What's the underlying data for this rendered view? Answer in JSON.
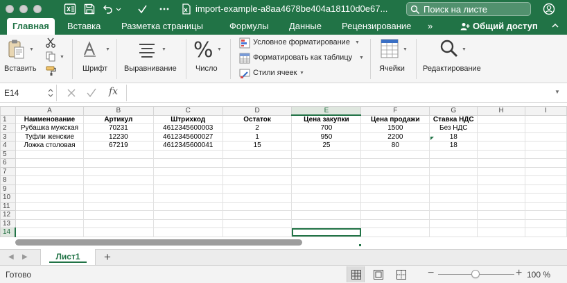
{
  "window": {
    "title": "import-example-a8aa4678be404a18110d0e67...",
    "search_placeholder": "Поиск на листе"
  },
  "ribbon": {
    "tabs": [
      {
        "label": "Главная",
        "active": true
      },
      {
        "label": "Вставка"
      },
      {
        "label": "Разметка страницы"
      },
      {
        "label": "Формулы"
      },
      {
        "label": "Данные"
      },
      {
        "label": "Рецензирование"
      }
    ],
    "more_tabs": "»",
    "share_label": "Общий доступ",
    "paste_label": "Вставить",
    "font_label": "Шрифт",
    "align_label": "Выравнивание",
    "number_label": "Число",
    "number_symbol": "%",
    "cond_format_label": "Условное форматирование",
    "format_table_label": "Форматировать как таблицу",
    "cell_styles_label": "Стили ячеек",
    "cells_label": "Ячейки",
    "editing_label": "Редактирование"
  },
  "formula_bar": {
    "name_box": "E14",
    "fx_label": "fx",
    "formula": ""
  },
  "sheet": {
    "columns": [
      "A",
      "B",
      "C",
      "D",
      "E",
      "F",
      "G",
      "H",
      "I"
    ],
    "selected_column": "E",
    "selected_row": 14,
    "active_cell": "E14",
    "header_row": [
      "Наименование",
      "Артикул",
      "Штрихкод",
      "Остаток",
      "Цена закупки",
      "Цена продажи",
      "Ставка НДС"
    ],
    "rows": [
      [
        "Рубашка мужская",
        "70231",
        "4612345600003",
        "2",
        "700",
        "1500",
        "Без НДС"
      ],
      [
        "Туфли женские",
        "12230",
        "4612345600027",
        "1",
        "950",
        "2200",
        "18"
      ],
      [
        "Ложка столовая",
        "67219",
        "4612345600041",
        "15",
        "25",
        "80",
        "18"
      ]
    ],
    "row_numbers": [
      "1",
      "2",
      "3",
      "4",
      "5",
      "6",
      "7",
      "8",
      "9",
      "10",
      "11",
      "12",
      "13",
      "14"
    ]
  },
  "sheet_tabs": {
    "tabs": [
      "Лист1"
    ],
    "active": "Лист1",
    "add_label": "+"
  },
  "status": {
    "text": "Готово",
    "zoom": "100 %",
    "zoom_minus": "−",
    "zoom_plus": "+"
  },
  "colors": {
    "accent": "#217346",
    "ribbon_bg": "#f5f5f5",
    "grid_line": "#e1e1e1"
  }
}
